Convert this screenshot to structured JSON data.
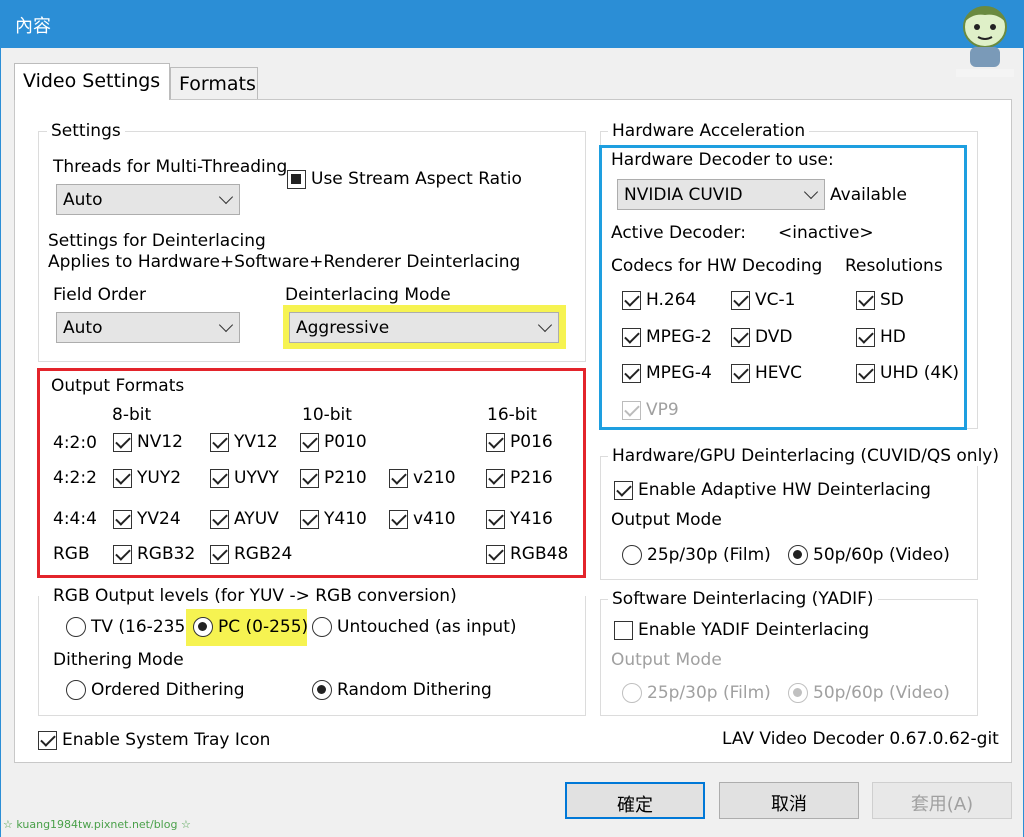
{
  "window": {
    "title": "內容"
  },
  "tabs": [
    {
      "label": "Video Settings",
      "active": true
    },
    {
      "label": "Formats",
      "active": false
    }
  ],
  "settings": {
    "title": "Settings",
    "threads_label": "Threads for Multi-Threading",
    "threads_value": "Auto",
    "stream_aspect_label": "Use Stream Aspect Ratio",
    "stream_aspect_state": "indeterminate",
    "deint_title": "Settings for Deinterlacing",
    "deint_desc": "Applies to Hardware+Software+Renderer Deinterlacing",
    "field_order_label": "Field Order",
    "field_order_value": "Auto",
    "deint_mode_label": "Deinterlacing Mode",
    "deint_mode_value": "Aggressive"
  },
  "output_formats": {
    "title": "Output Formats",
    "col_8bit": "8-bit",
    "col_10bit": "10-bit",
    "col_16bit": "16-bit",
    "rows": [
      {
        "label": "4:2:0",
        "items": [
          "NV12",
          "YV12",
          "P010",
          "P016"
        ]
      },
      {
        "label": "4:2:2",
        "items": [
          "YUY2",
          "UYVY",
          "P210",
          "v210",
          "P216"
        ]
      },
      {
        "label": "4:4:4",
        "items": [
          "YV24",
          "AYUV",
          "Y410",
          "v410",
          "Y416"
        ]
      },
      {
        "label": "RGB",
        "items": [
          "RGB32",
          "RGB24",
          "RGB48"
        ]
      }
    ]
  },
  "rgb_levels": {
    "label": "RGB Output levels (for YUV -> RGB conversion)",
    "options": [
      "TV (16-235)",
      "PC (0-255)",
      "Untouched (as input)"
    ],
    "selected": "PC (0-255)"
  },
  "dithering": {
    "label": "Dithering Mode",
    "options": [
      "Ordered Dithering",
      "Random Dithering"
    ],
    "selected": "Random Dithering"
  },
  "tray": {
    "label": "Enable System Tray Icon",
    "checked": true
  },
  "version": "LAV Video Decoder 0.67.0.62-git",
  "hw_accel": {
    "title": "Hardware Acceleration",
    "decoder_label": "Hardware Decoder to use:",
    "decoder_value": "NVIDIA CUVID",
    "decoder_status": "Available",
    "active_label": "Active Decoder:",
    "active_value": "<inactive>",
    "codecs_label": "Codecs for HW Decoding",
    "resolutions_label": "Resolutions",
    "codecs": [
      "H.264",
      "VC-1",
      "MPEG-2",
      "DVD",
      "MPEG-4",
      "HEVC",
      "VP9"
    ],
    "resolutions": [
      "SD",
      "HD",
      "UHD (4K)"
    ]
  },
  "hw_deint": {
    "title": "Hardware/GPU Deinterlacing (CUVID/QS only)",
    "enable_label": "Enable Adaptive HW Deinterlacing",
    "output_mode_label": "Output Mode",
    "options": [
      "25p/30p (Film)",
      "50p/60p (Video)"
    ],
    "selected": "50p/60p (Video)"
  },
  "sw_deint": {
    "title": "Software Deinterlacing (YADIF)",
    "enable_label": "Enable YADIF Deinterlacing",
    "output_mode_label": "Output Mode",
    "options": [
      "25p/30p (Film)",
      "50p/60p (Video)"
    ],
    "selected": "50p/60p (Video)"
  },
  "buttons": {
    "ok": "確定",
    "cancel": "取消",
    "apply": "套用(A)"
  },
  "watermark": "☆ kuang1984tw.pixnet.net/blog ☆",
  "colors": {
    "titlebar": "#2b8ed6",
    "highlight_yellow": "#f6f351",
    "red_box": "#e3242b",
    "blue_box": "#1e9fe0"
  }
}
